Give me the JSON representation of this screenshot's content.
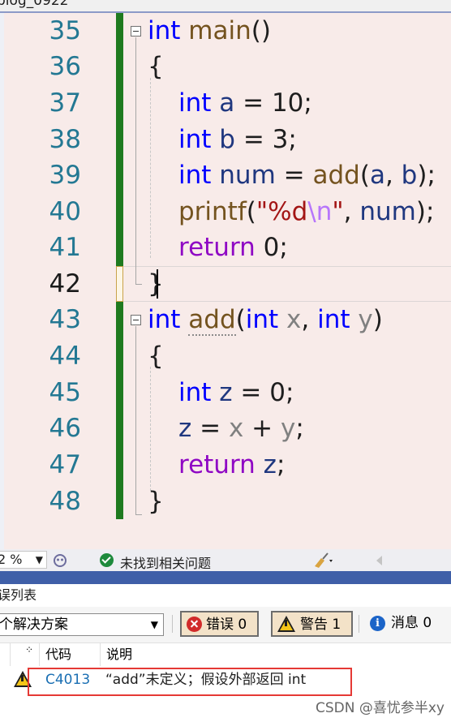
{
  "tab": {
    "filename": "blog_0922"
  },
  "editor": {
    "line_numbers": [
      "35",
      "36",
      "37",
      "38",
      "39",
      "40",
      "41",
      "42",
      "43",
      "44",
      "45",
      "46",
      "47",
      "48"
    ],
    "current_line": "42",
    "code": {
      "l35": {
        "kw": "int",
        "fn": "main",
        "rest": "()"
      },
      "l36": {
        "text": "{"
      },
      "l37": {
        "kw": "int",
        "var": "a",
        "rest": " = 10;"
      },
      "l38": {
        "kw": "int",
        "var": "b",
        "rest": " = 3;"
      },
      "l39": {
        "kw": "int",
        "var": "num",
        "eq": " = ",
        "fn": "add",
        "open": "(",
        "a1": "a",
        "comma": ", ",
        "a2": "b",
        "close": ");"
      },
      "l40": {
        "fn": "printf",
        "open": "(",
        "str1": "\"%d",
        "esc": "\\n",
        "str2": "\"",
        "comma": ", ",
        "var": "num",
        "close": ");"
      },
      "l41": {
        "kw": "return",
        "rest": " 0;"
      },
      "l42": {
        "text": "}"
      },
      "l43": {
        "kw": "int",
        "fn": "add",
        "open": "(",
        "kw2": "int",
        "p1": "x",
        "comma": ", ",
        "kw3": "int",
        "p2": "y",
        "close": ")"
      },
      "l44": {
        "text": "{"
      },
      "l45": {
        "kw": "int",
        "var": "z",
        "rest": " = 0;"
      },
      "l46": {
        "var": "z",
        "eq": " = ",
        "p1": "x",
        "plus": " + ",
        "p2": "y",
        "semi": ";"
      },
      "l47": {
        "kw": "return",
        "var": "z",
        "semi": ";"
      },
      "l48": {
        "text": "}"
      }
    }
  },
  "statusbar": {
    "zoom": "2 %",
    "issues_text": "未找到相关问题"
  },
  "error_list": {
    "title": "误列表",
    "scope": "个解决方案",
    "errors_btn": "错误 0",
    "warnings_btn": "警告 1",
    "messages_btn": "消息 0",
    "columns": {
      "code": "代码",
      "description": "说明"
    },
    "rows": [
      {
        "code": "C4013",
        "description": "“add”未定义；假设外部返回 int"
      }
    ]
  },
  "watermark": "CSDN @喜忧参半xy",
  "colors": {
    "keyword": "#0000ff",
    "control_keyword": "#8f08c4",
    "function": "#74531f",
    "variable": "#1f377f",
    "string": "#a31515",
    "changebar": "#1f7a1f",
    "highlight_box": "#e53935"
  }
}
